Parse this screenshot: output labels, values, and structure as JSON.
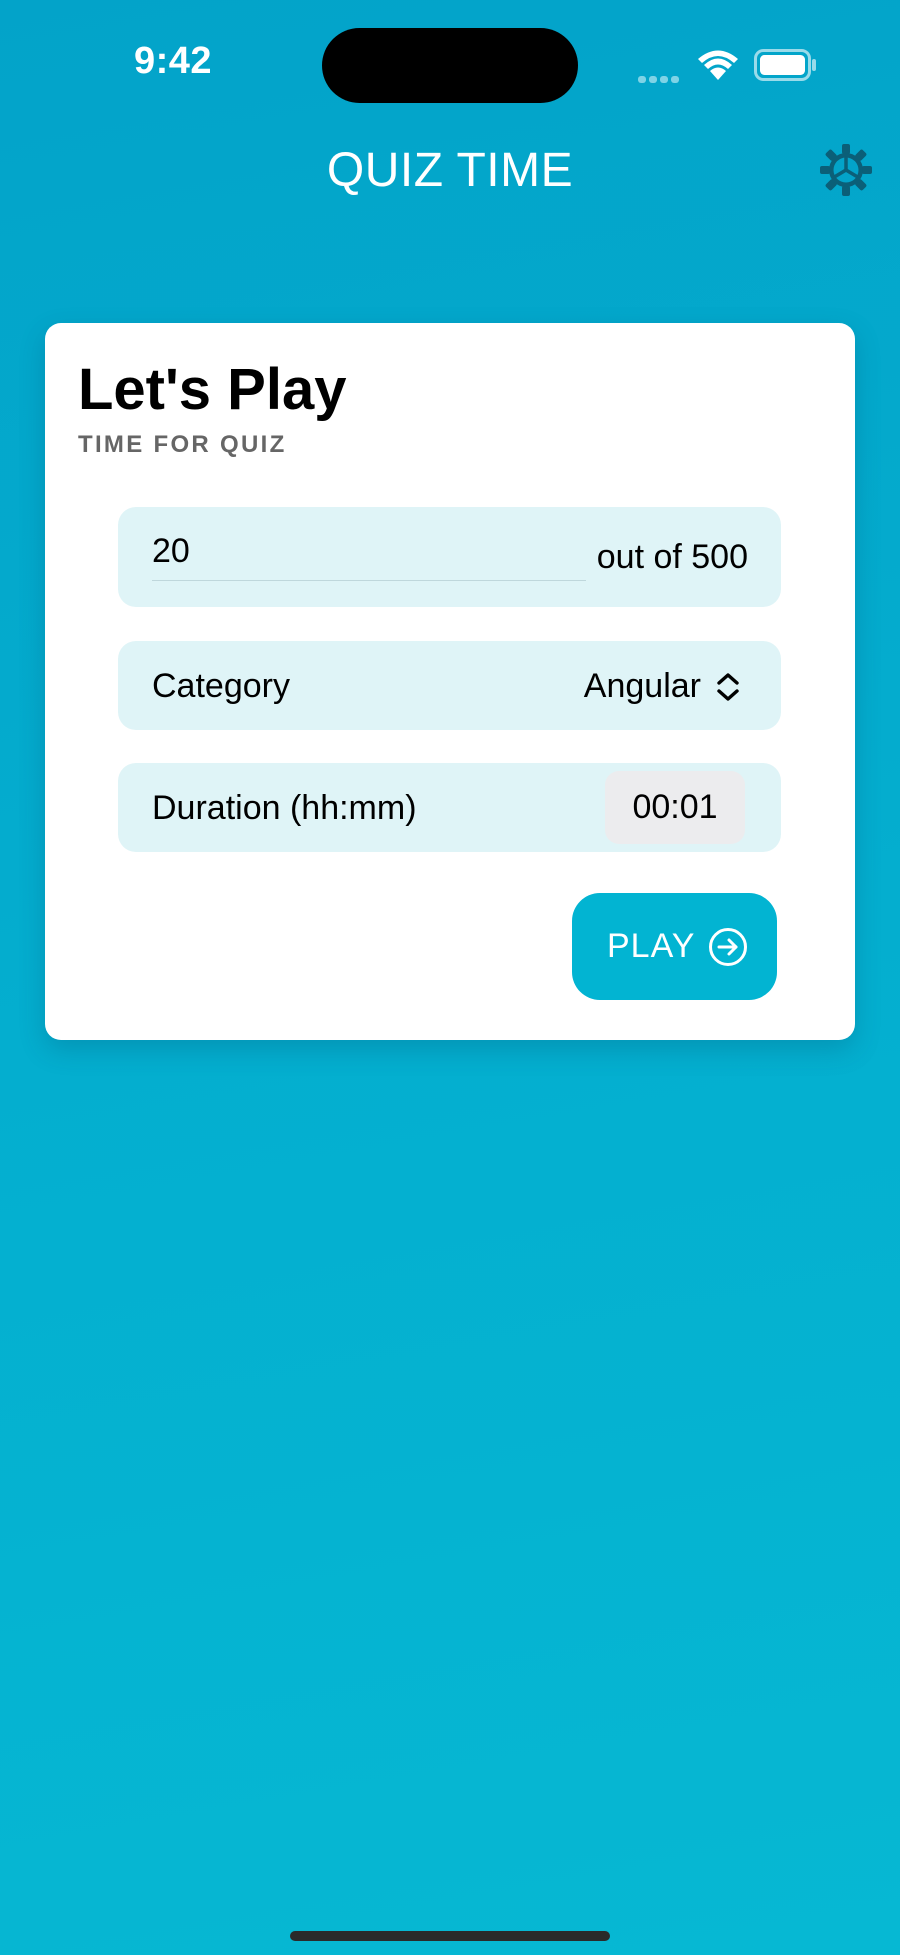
{
  "status_bar": {
    "time": "9:42"
  },
  "header": {
    "title": "QUIZ TIME",
    "settings_icon": "gear-icon"
  },
  "card": {
    "title": "Let's Play",
    "subtitle": "TIME FOR QUIZ",
    "question_count": {
      "value": "20",
      "suffix": "out of 500"
    },
    "category": {
      "label": "Category",
      "value": "Angular",
      "icon": "chevron-up-down-icon"
    },
    "duration": {
      "label": "Duration (hh:mm)",
      "value": "00:01"
    },
    "play_button": {
      "label": "PLAY",
      "icon": "arrow-right-circle-icon"
    }
  },
  "colors": {
    "background": "#03a3c9",
    "accent": "#02b4d2",
    "row_fill": "#dff4f7",
    "gear": "#0b5f78"
  }
}
